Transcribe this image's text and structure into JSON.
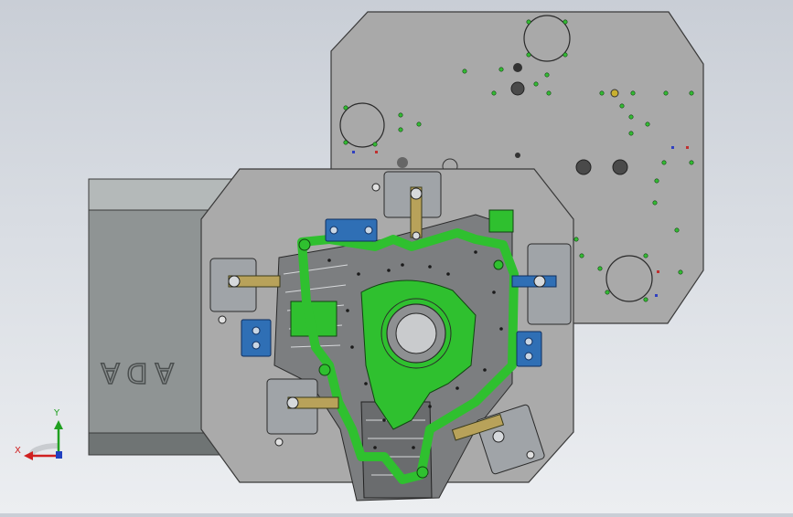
{
  "viewport": {
    "background_top": "#c9ced6",
    "background_bottom": "#eceef1"
  },
  "model": {
    "housing_side_text": "ADA",
    "colors": {
      "plate": "#a8a8a8",
      "plate_edge": "#3a3a3a",
      "housing": "#8f9494",
      "fixture_green": "#2fc02f",
      "clamp_blue": "#2f6fb5",
      "clamp_arm": "#b8a25a",
      "part_gray": "#7c7e80"
    }
  },
  "triad": {
    "x_label": "X",
    "y_label": "Y",
    "x_color": "#d02020",
    "y_color": "#20a020",
    "z_color": "#2040c0"
  }
}
